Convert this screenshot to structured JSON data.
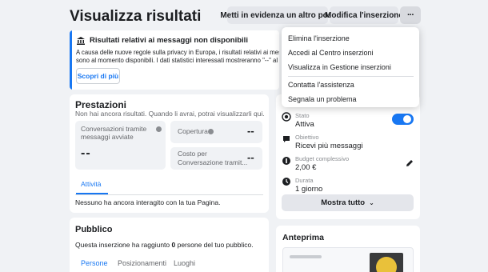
{
  "header": {
    "title": "Visualizza risultati",
    "boost_label": "Metti in evidenza un altro post",
    "edit_label": "Modifica l'inserzione",
    "more_label": "···"
  },
  "notice": {
    "title": "Risultati relativi ai messaggi non disponibili",
    "line1": "A causa delle nuove regole sulla privacy in Europa, i risultati relativi ai messaggi per le",
    "line2": "sono al momento disponibili. I dati statistici interessati mostreranno \"--\" al posto dell",
    "button": "Scopri di più"
  },
  "dropdown": {
    "items": [
      "Elimina l'inserzione",
      "Accedi al Centro inserzioni",
      "Visualizza in Gestione inserzioni",
      "Contatta l'assistenza",
      "Segnala un problema"
    ]
  },
  "performance": {
    "title": "Prestazioni",
    "subtitle": "Non hai ancora risultati. Quando li avrai, potrai visualizzarli qui.",
    "metric1_label_1": "Conversazioni tramite",
    "metric1_label_2": "messaggi avviate",
    "metric1_value": "--",
    "metric2_label": "Copertura",
    "metric2_value": "--",
    "metric3_label_1": "Costo per",
    "metric3_label_2": "Conversazione tramit...",
    "metric3_value": "--",
    "tab_activity": "Attività",
    "activity_text": "Nessuno ha ancora interagito con la tua Pagina."
  },
  "audience": {
    "title": "Pubblico",
    "text_before": "Questa inserzione ha raggiunto ",
    "count": "0",
    "text_after": " persone del tuo pubblico.",
    "tabs": [
      "Persone",
      "Posizionamenti",
      "Luoghi"
    ]
  },
  "details": {
    "status_label": "Stato",
    "status_value": "Attiva",
    "objective_label": "Obiettivo",
    "objective_value": "Ricevi più messaggi",
    "budget_label": "Budget complessivo",
    "budget_value": "2,00 €",
    "duration_label": "Durata",
    "duration_value": "1 giorno",
    "show_all": "Mostra tutto"
  },
  "preview": {
    "title": "Anteprima"
  },
  "colors": {
    "accent": "#1877f2",
    "background": "#f0f2f5",
    "button_grey": "#e4e6eb"
  }
}
